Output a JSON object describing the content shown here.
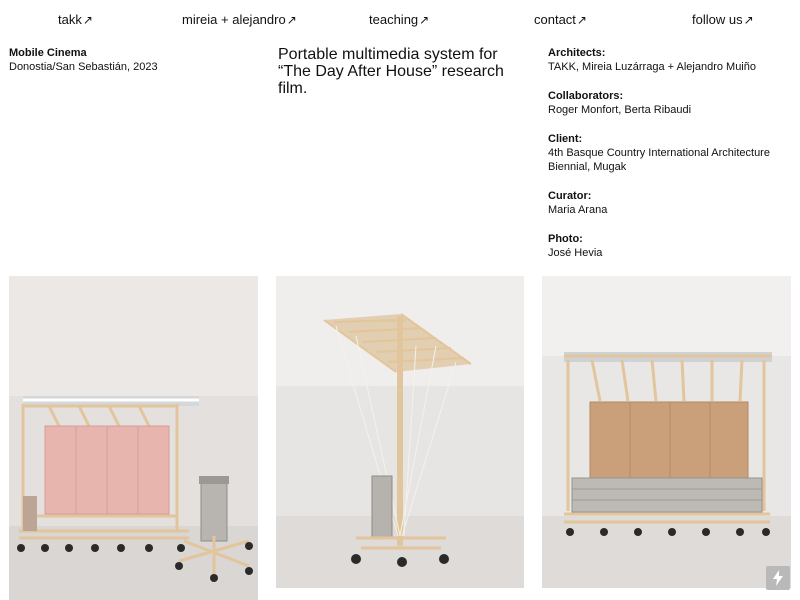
{
  "nav": {
    "takk": "takk",
    "founders": "mireia + alejandro",
    "teaching": "teaching",
    "contact": "contact",
    "follow": "follow us",
    "arrow": "↗"
  },
  "project": {
    "title": "Mobile Cinema",
    "location_year": "Donostia/San Sebastián, 2023",
    "description": "Portable multimedia system for “The Day After House” research film."
  },
  "credits": [
    {
      "label": "Architects:",
      "value": "TAKK, Mireia Luzárraga + Alejandro Muiño"
    },
    {
      "label": "Collaborators:",
      "value": "Roger Monfort, Berta Ribaudi"
    },
    {
      "label": "Client:",
      "value": "4th Basque Country International Architecture Biennial, Mugak"
    },
    {
      "label": "Curator:",
      "value": "Maria Arana"
    },
    {
      "label": "Photo:",
      "value": "José Hevia"
    }
  ],
  "photos": [
    {
      "subject": "mobile cinema with pink screen and stacked boxes on wheels"
    },
    {
      "subject": "mobile cinema side view with tilted canopy"
    },
    {
      "subject": "mobile cinema front view with cardboard screen"
    }
  ],
  "icons": {
    "arrow": "arrow-up-right-icon",
    "bolt": "lightning-bolt-icon"
  },
  "colors": {
    "background": "#ffffff",
    "text": "#111111",
    "wood": "#e3c9a1",
    "pink_panel": "#e6b2ad",
    "cardboard": "#c9a07a",
    "gallery_bg": "#e8e6e4"
  }
}
